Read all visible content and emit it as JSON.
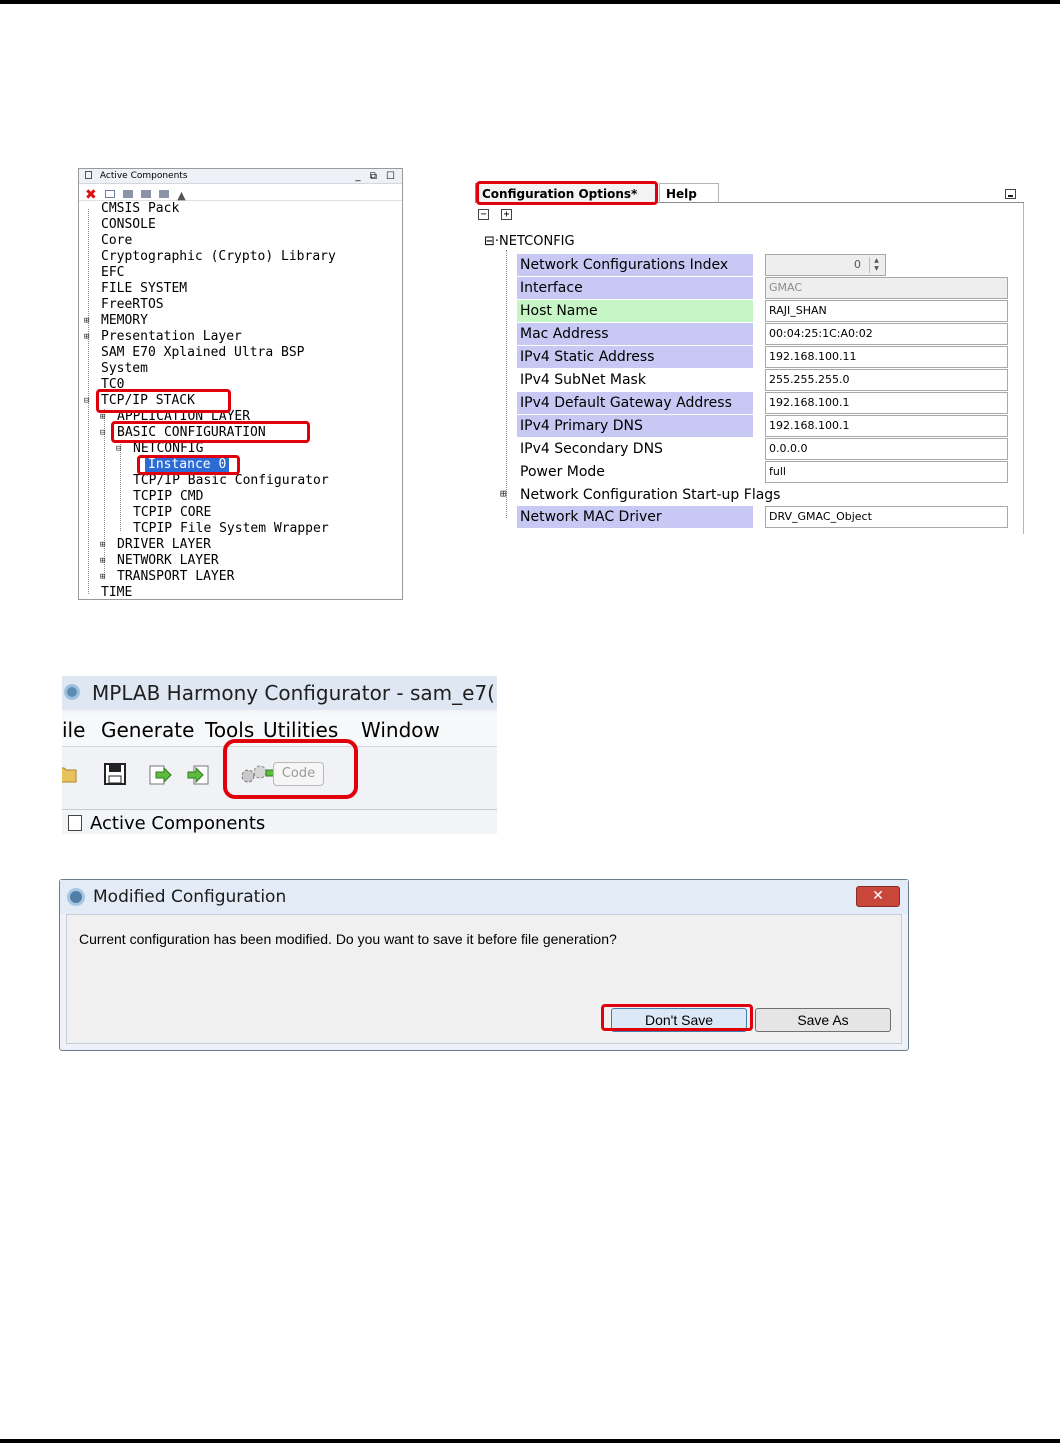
{
  "active_components": {
    "title": "Active Components",
    "window_buttons": "_ ⧉ ☐",
    "tree": [
      {
        "label": "CMSIS Pack"
      },
      {
        "label": "CONSOLE"
      },
      {
        "label": "Core"
      },
      {
        "label": "Cryptographic (Crypto) Library"
      },
      {
        "label": "EFC"
      },
      {
        "label": "FILE SYSTEM"
      },
      {
        "label": "FreeRTOS"
      },
      {
        "label": "MEMORY"
      },
      {
        "label": "Presentation Layer"
      },
      {
        "label": "SAM E70 Xplained Ultra BSP"
      },
      {
        "label": "System"
      },
      {
        "label": "TC0"
      },
      {
        "label": "TCP/IP STACK"
      },
      {
        "label": "APPLICATION LAYER"
      },
      {
        "label": "BASIC CONFIGURATION"
      },
      {
        "label": "NETCONFIG"
      },
      {
        "label": "Instance 0"
      },
      {
        "label": "TCP/IP Basic Configurator"
      },
      {
        "label": "TCPIP CMD"
      },
      {
        "label": "TCPIP CORE"
      },
      {
        "label": "TCPIP File System Wrapper"
      },
      {
        "label": "DRIVER LAYER"
      },
      {
        "label": "NETWORK LAYER"
      },
      {
        "label": "TRANSPORT LAYER"
      },
      {
        "label": "TIME"
      }
    ]
  },
  "config_options": {
    "tab_active": "Configuration Options*",
    "tab_help": "Help",
    "section": "NETCONFIG",
    "index_value": "0",
    "rows": [
      {
        "label": "Network Configurations Index",
        "value": "0"
      },
      {
        "label": "Interface",
        "value": "GMAC"
      },
      {
        "label": "Host Name",
        "value": "RAJI_SHAN"
      },
      {
        "label": "Mac Address",
        "value": "00:04:25:1C:A0:02"
      },
      {
        "label": "IPv4 Static Address",
        "value": "192.168.100.11"
      },
      {
        "label": "IPv4 SubNet Mask",
        "value": "255.255.255.0"
      },
      {
        "label": "IPv4 Default Gateway Address",
        "value": "192.168.100.1"
      },
      {
        "label": "IPv4 Primary DNS",
        "value": "192.168.100.1"
      },
      {
        "label": "IPv4 Secondary DNS",
        "value": "0.0.0.0"
      },
      {
        "label": "Power Mode",
        "value": "full"
      },
      {
        "label": "Network Configuration Start-up Flags",
        "value": ""
      },
      {
        "label": "Network MAC Driver",
        "value": "DRV_GMAC_Object"
      }
    ]
  },
  "harmony": {
    "title": "MPLAB Harmony Configurator - sam_e7(",
    "menu": [
      "ile",
      "Generate",
      "Tools",
      "Utilities",
      "Window"
    ],
    "code_button": "Code",
    "active_components": "Active Components"
  },
  "dialog": {
    "title": "Modified Configuration",
    "close": "✕",
    "message": "Current configuration has been modified.  Do you want to save it before file generation?",
    "dont_save": "Don't Save",
    "save_as": "Save As"
  }
}
